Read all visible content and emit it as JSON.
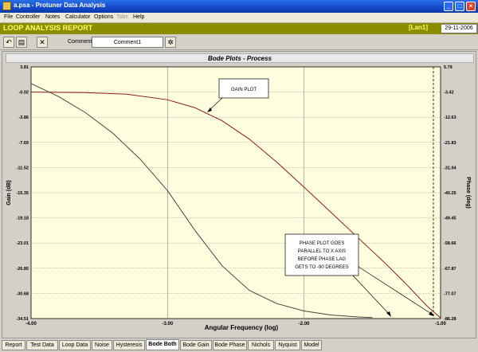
{
  "window": {
    "title": "a.psa - Protuner Data  Analysis"
  },
  "menu": [
    "File",
    "Controller",
    "Notes",
    "Calculator",
    "Options",
    "Tabs",
    "Help"
  ],
  "header": {
    "title": "LOOP ANALYSIS REPORT",
    "badge": "[Lan1]",
    "date": "29-11-2006"
  },
  "toolbar": {
    "comment_label": "Comment",
    "comment_value": "Comment1"
  },
  "chart_data": {
    "type": "line",
    "title": "Bode Plots - Process",
    "xlabel": "Angular Frequency (log)",
    "ylabel_left": "Gain (dB)",
    "ylabel_right": "Phase (deg)",
    "x_ticks": [
      "-4.00",
      "-3.00",
      "-2.00",
      "-1.00"
    ],
    "y_left_ticks": [
      "3.81",
      "-0.02",
      "-3.86",
      "-7.69",
      "-11.52",
      "-15.35",
      "-19.18",
      "-23.01",
      "-26.85",
      "-30.68",
      "-34.51"
    ],
    "y_right_ticks": [
      "5.79",
      "-3.42",
      "-12.63",
      "-21.83",
      "-31.04",
      "-40.25",
      "-49.45",
      "-58.66",
      "-67.87",
      "-77.07",
      "-86.28"
    ],
    "xlim": [
      -4.0,
      -1.0
    ],
    "ylim_left": [
      -34.51,
      3.81
    ],
    "ylim_right": [
      -86.28,
      5.79
    ],
    "grid": true,
    "series": [
      {
        "axis": "left",
        "color": "#8b1a1a",
        "x": [
          -4.0,
          -3.6,
          -3.3,
          -3.0,
          -2.8,
          -2.6,
          -2.4,
          -2.2,
          -2.0,
          -1.8,
          -1.6,
          -1.4,
          -1.25,
          -1.1,
          -1.0
        ],
        "y": [
          -0.02,
          -0.1,
          -0.35,
          -1.2,
          -2.4,
          -4.4,
          -7.2,
          -10.7,
          -14.5,
          -18.4,
          -22.3,
          -26.2,
          -29.3,
          -32.6,
          -34.4
        ]
      },
      {
        "axis": "right",
        "color": "#444444",
        "x": [
          -4.0,
          -3.8,
          -3.6,
          -3.4,
          -3.2,
          -3.0,
          -2.8,
          -2.6,
          -2.4,
          -2.2,
          -2.0,
          -1.8,
          -1.6,
          -1.5
        ],
        "y": [
          -0.3,
          -5.0,
          -11.0,
          -18.5,
          -28.0,
          -39.5,
          -54.0,
          -67.0,
          -76.0,
          -80.8,
          -83.5,
          -85.0,
          -85.7,
          -85.9
        ]
      }
    ],
    "annotations": [
      {
        "text": "GAIN PLOT"
      },
      {
        "text": [
          "PHASE PLOT GOES",
          "PARALLEL TO X AXIS",
          "BEFORE PHASE LAG",
          "GETS TO -90 DEGREES"
        ]
      }
    ]
  },
  "tabs": [
    "Report",
    "Test Data",
    "Loop Data",
    "Noise",
    "Hysteresis",
    "Bode Both",
    "Bode Gain",
    "Bode Phase",
    "Nichols",
    "Nyquist",
    "Model"
  ],
  "active_tab": "Bode Both"
}
